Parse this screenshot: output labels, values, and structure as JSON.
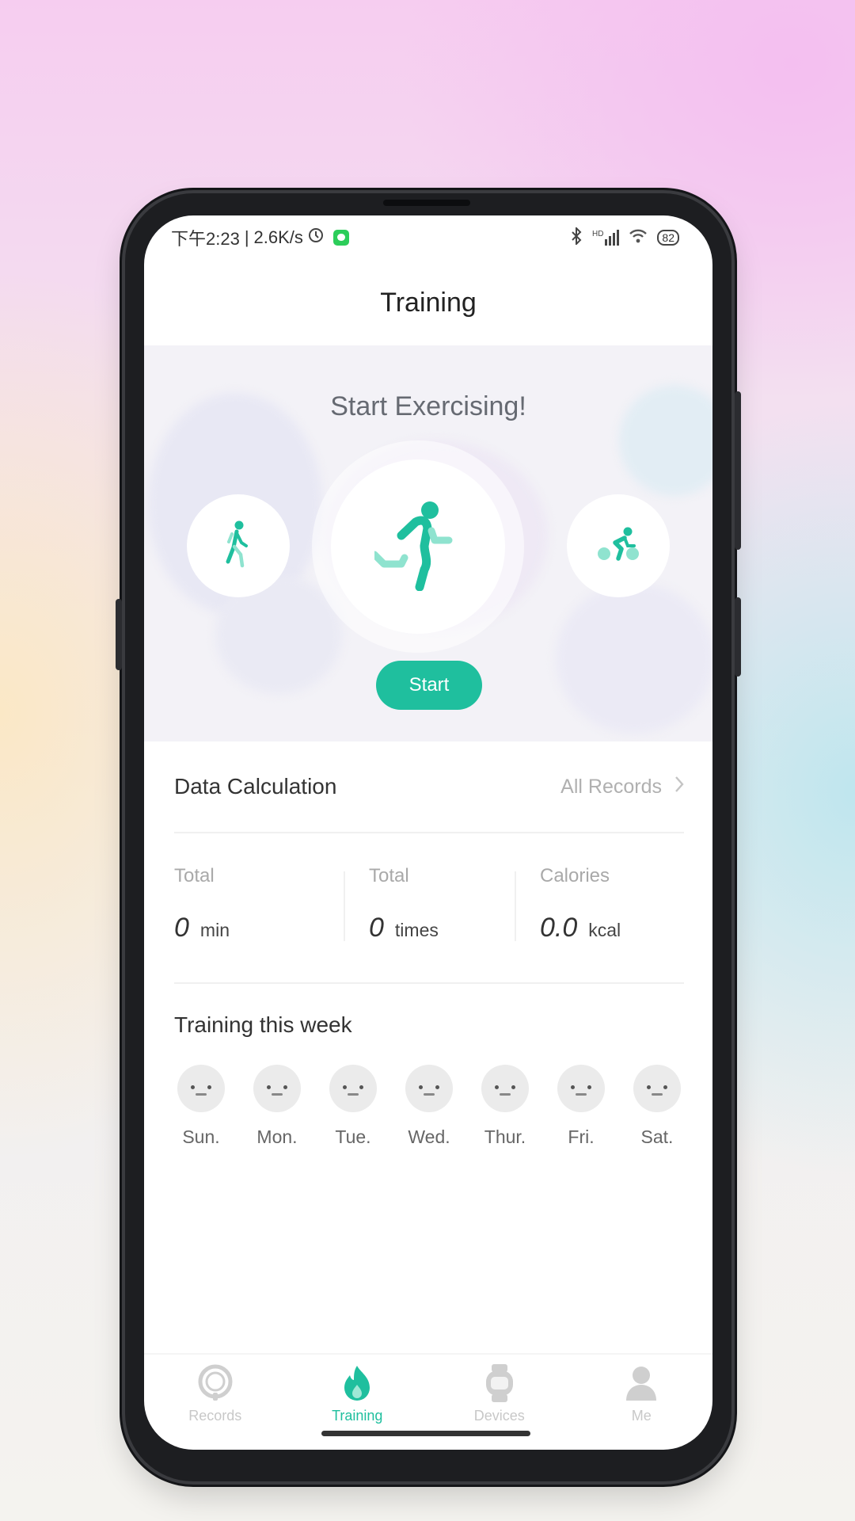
{
  "status_bar": {
    "time": "下午2:23",
    "separator": "|",
    "network_speed": "2.6K/s",
    "alarm_icon": "alarm-clock-icon",
    "app_icon": "messaging-app-icon",
    "bluetooth_icon": "bluetooth-icon",
    "signal_label": "HD",
    "wifi_icon": "wifi-icon",
    "battery": "82"
  },
  "header": {
    "title": "Training"
  },
  "hero": {
    "title": "Start Exercising!",
    "sports": [
      {
        "name": "walking",
        "icon": "walking-icon"
      },
      {
        "name": "running",
        "icon": "running-icon",
        "selected": true
      },
      {
        "name": "cycling",
        "icon": "cycling-icon"
      }
    ],
    "start_label": "Start"
  },
  "colors": {
    "accent": "#1fbf9e",
    "accent_light": "#8fe3cf"
  },
  "data_calc": {
    "title": "Data Calculation",
    "link_label": "All Records",
    "stats": [
      {
        "label": "Total",
        "value": "0",
        "unit": "min"
      },
      {
        "label": "Total",
        "value": "0",
        "unit": "times"
      },
      {
        "label": "Calories",
        "value": "0.0",
        "unit": "kcal"
      }
    ]
  },
  "week": {
    "title": "Training this week",
    "days": [
      "Sun.",
      "Mon.",
      "Tue.",
      "Wed.",
      "Thur.",
      "Fri.",
      "Sat."
    ]
  },
  "tabbar": {
    "tabs": [
      {
        "label": "Records",
        "icon": "records-icon",
        "active": false
      },
      {
        "label": "Training",
        "icon": "flame-icon",
        "active": true
      },
      {
        "label": "Devices",
        "icon": "watch-icon",
        "active": false
      },
      {
        "label": "Me",
        "icon": "person-icon",
        "active": false
      }
    ]
  }
}
